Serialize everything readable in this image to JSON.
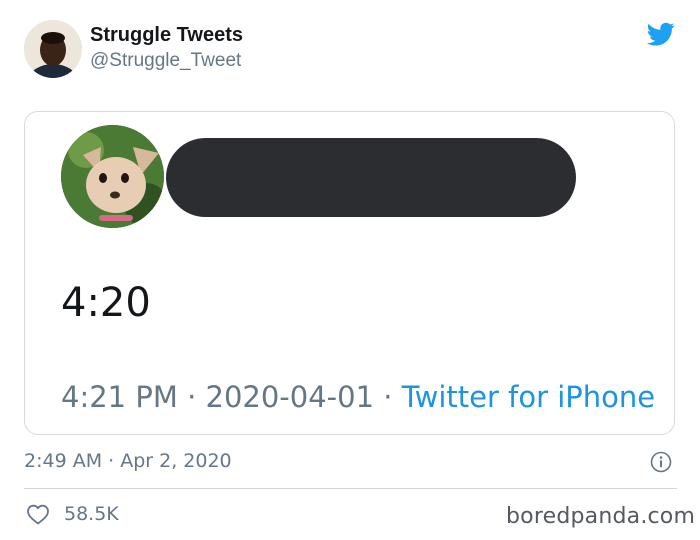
{
  "author": {
    "display_name": "Struggle Tweets",
    "handle": "@Struggle_Tweet"
  },
  "quoted_tweet": {
    "text": "4:20",
    "meta_time_date": "4:21 PM · 2020-04-01 · ",
    "source": "Twitter for iPhone"
  },
  "tweet": {
    "timestamp": "2:49 AM · Apr 2, 2020",
    "likes": "58.5K"
  },
  "watermark": "boredpanda.com",
  "icons": {
    "brand": "twitter-bird-icon",
    "info": "info-icon",
    "like": "heart-icon"
  },
  "colors": {
    "twitter_blue": "#1da1f2",
    "link_blue": "#1b95e0",
    "muted_gray": "#657786",
    "redaction": "#2b2d30"
  }
}
